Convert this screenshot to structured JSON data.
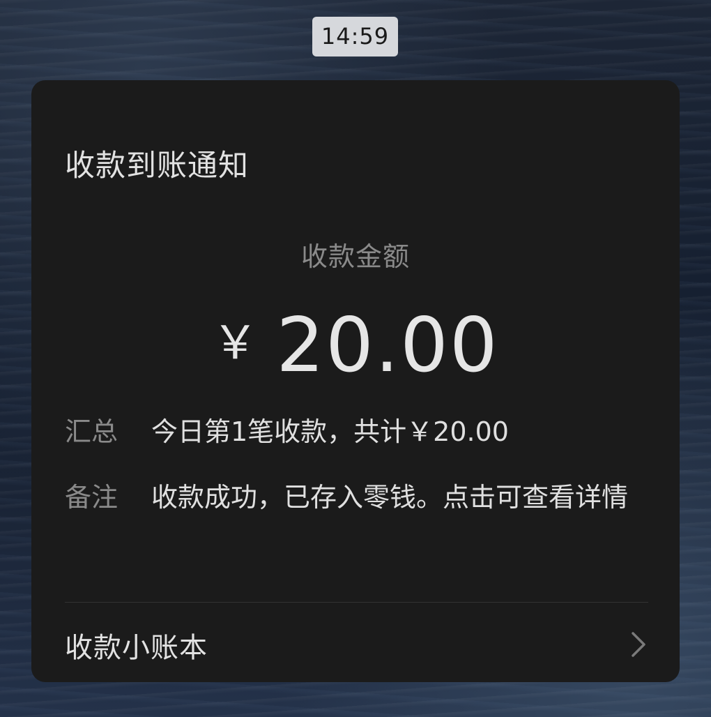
{
  "status": {
    "time": "14:59"
  },
  "notification": {
    "title": "收款到账通知",
    "amount_label": "收款金额",
    "currency_symbol": "￥",
    "amount": "20.00",
    "summary_label": "汇总",
    "summary_value": "今日第1笔收款，共计￥20.00",
    "remark_label": "备注",
    "remark_value": "收款成功，已存入零钱。点击可查看详情",
    "footer_link": "收款小账本"
  },
  "icons": {
    "footer_arrow": "chevron-right-icon"
  },
  "colors": {
    "card_background": "#1b1b1b",
    "time_pill_background": "#d6d8dc"
  }
}
